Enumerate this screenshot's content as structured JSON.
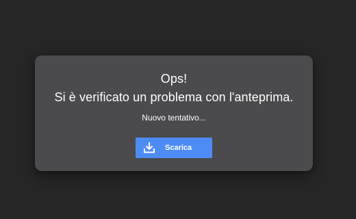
{
  "error": {
    "title": "Ops!",
    "message": "Si è verificato un problema con l'anteprima.",
    "retry_label": "Nuovo tentativo...",
    "download_label": "Scarica",
    "download_icon": "download-icon"
  },
  "colors": {
    "page_background": "#262626",
    "card_background": "#4b4a4d",
    "button_background": "#4e8cf5",
    "text": "#ffffff"
  }
}
